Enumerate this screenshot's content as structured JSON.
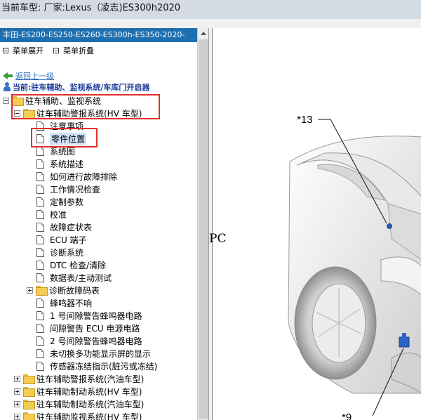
{
  "title_bar": "当前车型:  厂家:Lexus（凌志)ES300h2020",
  "left_panel": {
    "vehicle_title": "丰田-ES200-ES250-ES260-ES300h-ES350-2020-",
    "expand_all": "菜单展开",
    "collapse_all": "菜单折叠",
    "back_link": "返回上一级",
    "current_path": "当前:驻车辅助、监视系统/车库门开启器",
    "tree": [
      {
        "label": "驻车辅助、监视系统",
        "type": "folder",
        "toggle": "minus",
        "level": 0
      },
      {
        "label": "驻车辅助警报系统(HV 车型)",
        "type": "folder",
        "toggle": "minus",
        "level": 1
      },
      {
        "label": "注意事项",
        "type": "doc",
        "level": 2
      },
      {
        "label": "零件位置",
        "type": "doc",
        "level": 2,
        "selected": true
      },
      {
        "label": "系统图",
        "type": "doc",
        "level": 2
      },
      {
        "label": "系统描述",
        "type": "doc",
        "level": 2
      },
      {
        "label": "如何进行故障排除",
        "type": "doc",
        "level": 2
      },
      {
        "label": "工作情况检查",
        "type": "doc",
        "level": 2
      },
      {
        "label": "定制参数",
        "type": "doc",
        "level": 2
      },
      {
        "label": "校准",
        "type": "doc",
        "level": 2
      },
      {
        "label": "故障症状表",
        "type": "doc",
        "level": 2
      },
      {
        "label": "ECU 端子",
        "type": "doc",
        "level": 2
      },
      {
        "label": "诊断系统",
        "type": "doc",
        "level": 2
      },
      {
        "label": "DTC 检查/清除",
        "type": "doc",
        "level": 2
      },
      {
        "label": "数据表/主动测试",
        "type": "doc",
        "level": 2
      },
      {
        "label": "诊断故障码表",
        "type": "folder",
        "toggle": "plus",
        "level": 2
      },
      {
        "label": "蜂鸣器不响",
        "type": "doc",
        "level": 2
      },
      {
        "label": "1 号间隙警告蜂鸣器电路",
        "type": "doc",
        "level": 2
      },
      {
        "label": "间隙警告 ECU 电源电路",
        "type": "doc",
        "level": 2
      },
      {
        "label": "2 号间隙警告蜂鸣器电路",
        "type": "doc",
        "level": 2
      },
      {
        "label": "未切换多功能显示屏的显示",
        "type": "doc",
        "level": 2
      },
      {
        "label": "传感器冻结指示(脏污或冻结)",
        "type": "doc",
        "level": 2
      },
      {
        "label": "驻车辅助警报系统(汽油车型)",
        "type": "folder",
        "toggle": "plus",
        "level": 1
      },
      {
        "label": "驻车辅助制动系统(HV 车型)",
        "type": "folder",
        "toggle": "plus",
        "level": 1
      },
      {
        "label": "驻车辅助制动系统(汽油车型)",
        "type": "folder",
        "toggle": "plus",
        "level": 1
      },
      {
        "label": "驻车辅助监视系统(HV 车型)",
        "type": "folder",
        "toggle": "plus",
        "level": 1
      }
    ]
  },
  "viewer": {
    "page_fragment": "PC",
    "callouts": [
      "*13",
      "*9"
    ]
  },
  "colors": {
    "highlight_box": "#e0312c",
    "title_bg": "#1e6fb0",
    "selection": "#cfe0f7"
  }
}
